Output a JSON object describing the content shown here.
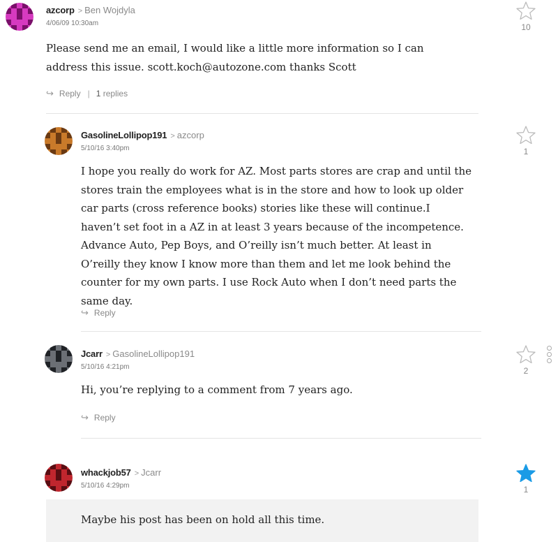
{
  "comments": [
    {
      "author": "azcorp",
      "parent": "Ben Wojdyla",
      "timestamp": "4/06/09 10:30am",
      "body": "Please send me an email, I would like a little more information so I can address this issue. scott.koch@autozone.com thanks Scott",
      "reply_label": "Reply",
      "replies_count": "1",
      "replies_label": "replies",
      "star_count": "10",
      "starred": false,
      "avatar_colors": [
        "#d63ac0",
        "#7a0f6a"
      ]
    },
    {
      "author": "GasolineLollipop191",
      "parent": "azcorp",
      "timestamp": "5/10/16 3:40pm",
      "body": "I hope you really do work for AZ. Most parts stores are crap and until the stores train the employees what is in the store and how to look up older car parts (cross reference books) stories like these will continue.I haven’t set foot in a AZ in at least 3 years because of the incompetence. Advance Auto, Pep Boys, and O’reilly isn’t much better. At least in O’reilly they know I know more than them and let me look behind the counter for my own parts. I use Rock Auto when I don’t need parts the same day.",
      "reply_label": "Reply",
      "star_count": "1",
      "starred": false,
      "avatar_colors": [
        "#c97a2a",
        "#6b3a12"
      ]
    },
    {
      "author": "Jcarr",
      "parent": "GasolineLollipop191",
      "timestamp": "5/10/16 4:21pm",
      "body": "Hi, you’re replying to a comment from 7 years ago.",
      "reply_label": "Reply",
      "star_count": "2",
      "starred": false,
      "avatar_colors": [
        "#6b6f75",
        "#1f2226"
      ]
    },
    {
      "author": "whackjob57",
      "parent": "Jcarr",
      "timestamp": "5/10/16 4:29pm",
      "body": "Maybe his post has been on hold all this time.",
      "star_count": "1",
      "starred": true,
      "avatar_colors": [
        "#c0262e",
        "#5a0d12"
      ]
    }
  ],
  "icons": {
    "star": "star-icon",
    "reply": "reply-arrow-icon",
    "chevron": "chevron-right-icon",
    "more": "more-options-icon"
  },
  "colors": {
    "star_outline": "#bbbbbb",
    "star_active": "#1a9be6",
    "highlight_bg": "#f2f2f2"
  }
}
